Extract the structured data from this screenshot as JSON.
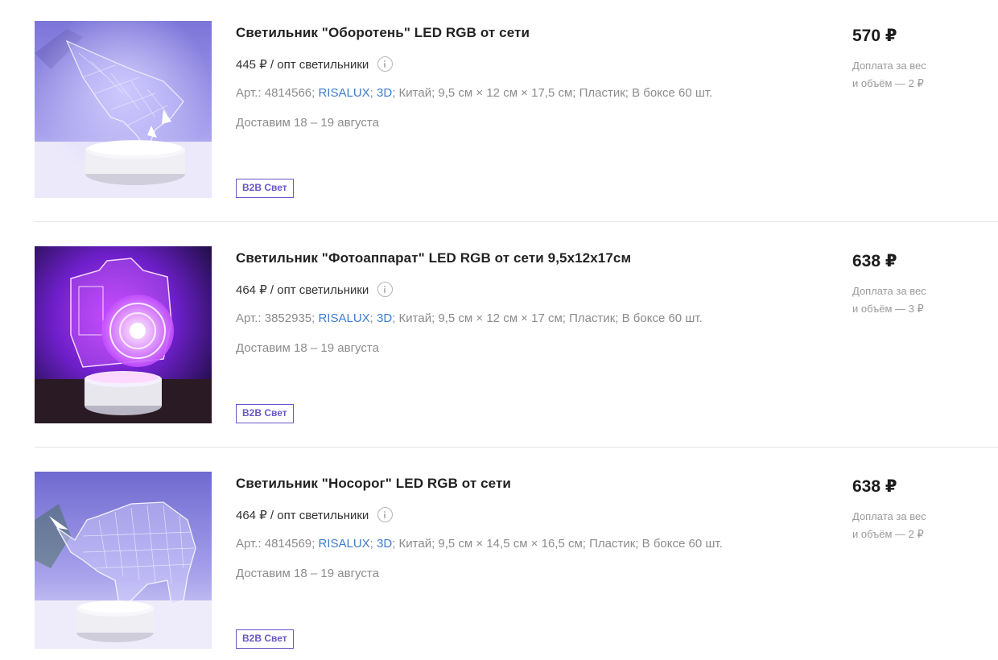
{
  "currency_symbol": "₽",
  "products": [
    {
      "title": "Светильник \"Оборотень\" LED RGB от сети",
      "wholesale_price": "445 ₽ / опт светильники",
      "spec_article": "Арт.: 4814566;",
      "spec_brand": "RISALUX",
      "spec_sep1": ";",
      "spec_type": "3D",
      "spec_rest": "; Китай; 9,5 см × 12 см × 17,5 см; Пластик; В боксе 60 шт.",
      "delivery": "Доставим 18 – 19 августа",
      "badge": "B2B Свет",
      "price": "570 ₽",
      "surcharge_line1": "Доплата за вес",
      "surcharge_line2": "и объём — 2 ₽",
      "image_icon": "wolf-lamp-image"
    },
    {
      "title": "Светильник \"Фотоаппарат\" LED RGB от сети 9,5х12х17см",
      "wholesale_price": "464 ₽ / опт светильники",
      "spec_article": "Арт.: 3852935;",
      "spec_brand": "RISALUX",
      "spec_sep1": ";",
      "spec_type": "3D",
      "spec_rest": "; Китай; 9,5 см × 12 см × 17 см; Пластик; В боксе 60 шт.",
      "delivery": "Доставим 18 – 19 августа",
      "badge": "B2B Свет",
      "price": "638 ₽",
      "surcharge_line1": "Доплата за вес",
      "surcharge_line2": "и объём — 3 ₽",
      "image_icon": "camera-lamp-image"
    },
    {
      "title": "Светильник \"Носорог\" LED RGB от сети",
      "wholesale_price": "464 ₽ / опт светильники",
      "spec_article": "Арт.: 4814569;",
      "spec_brand": "RISALUX",
      "spec_sep1": ";",
      "spec_type": "3D",
      "spec_rest": "; Китай; 9,5 см × 14,5 см × 16,5 см; Пластик; В боксе 60 шт.",
      "delivery": "Доставим 18 – 19 августа",
      "badge": "B2B Свет",
      "price": "638 ₽",
      "surcharge_line1": "Доплата за вес",
      "surcharge_line2": "и объём — 2 ₽",
      "image_icon": "rhino-lamp-image"
    }
  ],
  "colors": {
    "link": "#3d7ccf",
    "badge": "#6a56c9",
    "muted_text": "#8c8c8c",
    "divider": "#e2e2e2"
  }
}
